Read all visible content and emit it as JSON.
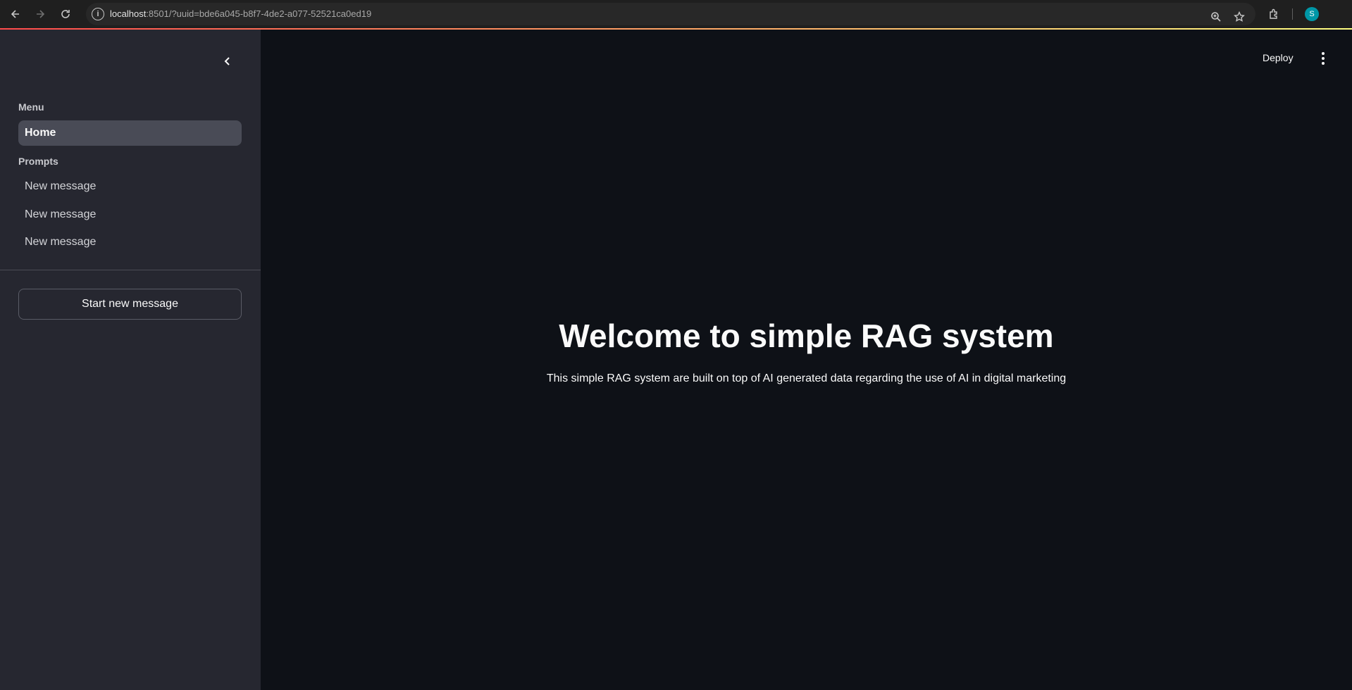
{
  "browser": {
    "url_host": "localhost",
    "url_rest": ":8501/?uuid=bde6a045-b8f7-4de2-a077-52521ca0ed19",
    "avatar_initial": "S",
    "icons": [
      "back-arrow-icon",
      "forward-arrow-icon",
      "reload-icon",
      "site-info-icon",
      "zoom-icon",
      "star-icon",
      "extensions-icon"
    ]
  },
  "sidebar": {
    "menu_label": "Menu",
    "home_label": "Home",
    "prompts_label": "Prompts",
    "prompts": [
      {
        "label": "New message"
      },
      {
        "label": "New message"
      },
      {
        "label": "New message"
      }
    ],
    "start_button": "Start new message"
  },
  "header": {
    "deploy_label": "Deploy"
  },
  "main": {
    "title": "Welcome to simple RAG system",
    "subtitle": "This simple RAG system are built on top of AI generated data regarding the use of AI in digital marketing"
  },
  "colors": {
    "app_bg": "#0e1117",
    "sidebar_bg": "#262730",
    "active_item_bg": "#494b56",
    "text": "#fafafa",
    "accent_gradient_start": "#ff4b4b",
    "accent_gradient_end": "#fffd80"
  }
}
